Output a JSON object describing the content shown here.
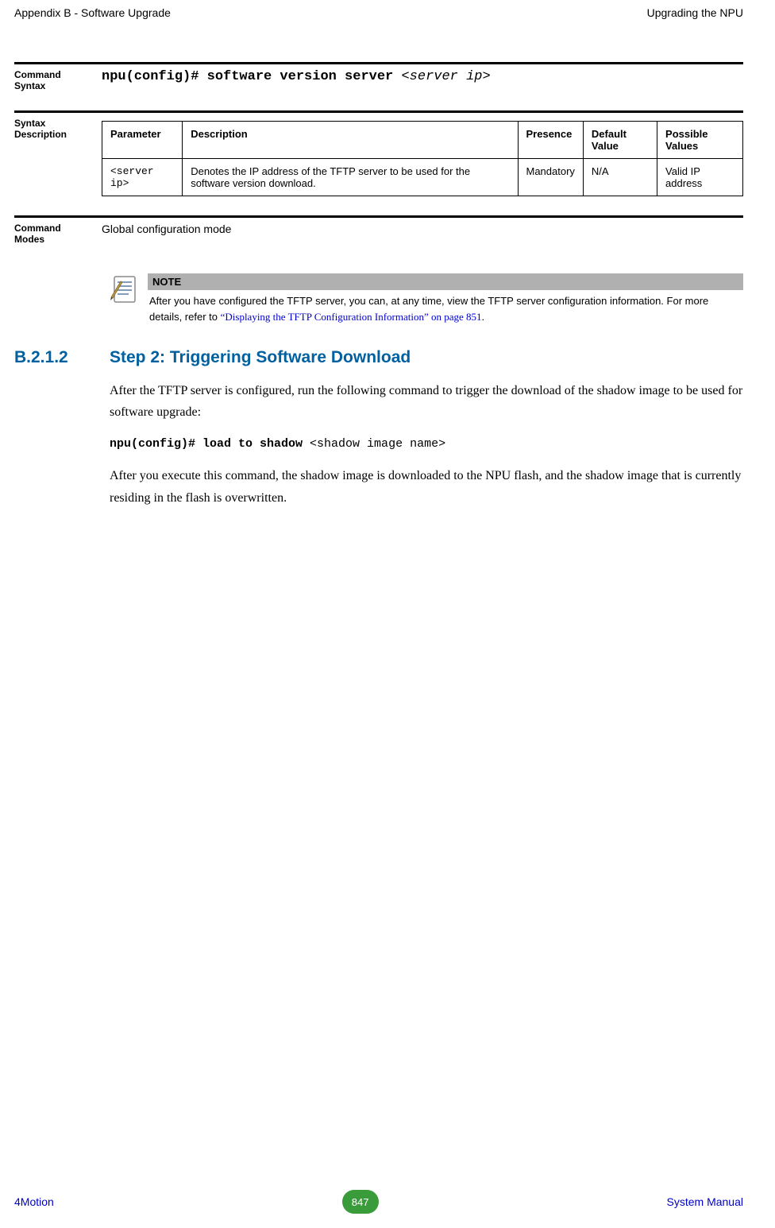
{
  "header": {
    "left": "Appendix B - Software Upgrade",
    "right": "Upgrading the NPU"
  },
  "cmd_syntax": {
    "label": "Command Syntax",
    "prefix": "npu(config)# software version server ",
    "param": "<server ip>"
  },
  "syntax_desc": {
    "label": "Syntax Description",
    "headers": {
      "parameter": "Parameter",
      "description": "Description",
      "presence": "Presence",
      "default": "Default Value",
      "possible": "Possible Values"
    },
    "row": {
      "parameter": "<server ip>",
      "description": "Denotes the IP address of the TFTP server to be used for the software version download.",
      "presence": "Mandatory",
      "default": "N/A",
      "possible": "Valid IP address"
    }
  },
  "cmd_modes": {
    "label": "Command Modes",
    "text": "Global configuration mode"
  },
  "note": {
    "header": "NOTE",
    "text_plain": "After you have configured the TFTP server, you can, at any time, view the TFTP server configuration information. For more details, refer to ",
    "link_text": "“Displaying the TFTP Configuration Information” on page 851",
    "suffix": "."
  },
  "section": {
    "number": "B.2.1.2",
    "title": "Step 2: Triggering Software Download",
    "para1": "After the TFTP server is configured, run the following command to trigger the download of the shadow image to be used for software upgrade:",
    "cmd_bold": "npu(config)# load to shadow ",
    "cmd_param": "<shadow image name>",
    "para2": "After you execute this command, the shadow image is downloaded to the NPU flash, and the shadow image that is currently residing in the flash is overwritten."
  },
  "footer": {
    "left": "4Motion",
    "page": "847",
    "right": "System Manual"
  }
}
